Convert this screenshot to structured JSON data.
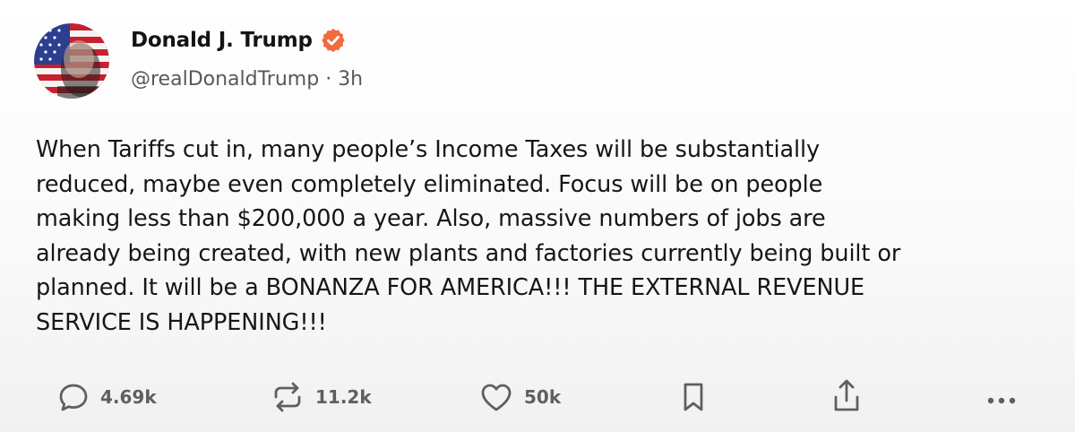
{
  "author": {
    "display_name": "Donald J. Trump",
    "handle": "@realDonaldTrump",
    "separator": "·",
    "time_ago": "3h",
    "verified": true,
    "verified_color": "#f26a3d",
    "avatar_icon": "flag-portrait-avatar"
  },
  "post": {
    "lines": [
      "When Tariffs cut in, many people’s Income Taxes will be substantially",
      "reduced, maybe even completely eliminated. Focus will be on people",
      "making less than $200,000 a year. Also, massive numbers of jobs are",
      "already being created, with new plants and factories currently being built or",
      "planned. It will be a BONANZA FOR AMERICA!!! THE EXTERNAL REVENUE",
      "SERVICE IS HAPPENING!!!"
    ]
  },
  "actions": {
    "replies": {
      "icon": "reply-icon",
      "count": "4.69k"
    },
    "reposts": {
      "icon": "repost-icon",
      "count": "11.2k"
    },
    "likes": {
      "icon": "heart-icon",
      "count": "50k"
    },
    "bookmark": {
      "icon": "bookmark-icon"
    },
    "share": {
      "icon": "share-icon"
    },
    "more": {
      "icon": "more-icon"
    }
  },
  "colors": {
    "text": "#161616",
    "muted": "#585858",
    "icon": "#5f5f5f",
    "background": "#ffffff"
  }
}
